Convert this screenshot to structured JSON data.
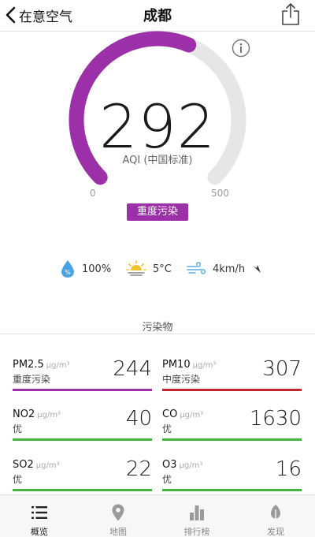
{
  "nav": {
    "back_label": "在意空气",
    "title": "成都"
  },
  "aqi": {
    "value": "292",
    "label": "AQI (中国标准)",
    "scale_min": "0",
    "scale_max": "500",
    "level": "重度污染",
    "fraction": 0.584,
    "color": "#9c30a9",
    "track_color": "#e6e6e6"
  },
  "weather": {
    "humidity": "100%",
    "temperature": "5°C",
    "wind": "4km/h"
  },
  "section_title": "污染物",
  "pollutants": [
    {
      "name": "PM2.5",
      "unit": "µg/m³",
      "level": "重度污染",
      "value": "244",
      "color": "#9c30a9"
    },
    {
      "name": "PM10",
      "unit": "µg/m³",
      "level": "中度污染",
      "value": "307",
      "color": "#c0272d"
    },
    {
      "name": "NO2",
      "unit": "µg/m³",
      "level": "优",
      "value": "40",
      "color": "#44b83a"
    },
    {
      "name": "CO",
      "unit": "µg/m³",
      "level": "优",
      "value": "1630",
      "color": "#44b83a"
    },
    {
      "name": "SO2",
      "unit": "µg/m³",
      "level": "优",
      "value": "22",
      "color": "#44b83a"
    },
    {
      "name": "O3",
      "unit": "µg/m³",
      "level": "优",
      "value": "16",
      "color": "#44b83a"
    }
  ],
  "tabs": [
    {
      "label": "概览",
      "icon": "list-icon",
      "active": true
    },
    {
      "label": "地图",
      "icon": "map-pin-icon",
      "active": false
    },
    {
      "label": "排行榜",
      "icon": "bar-chart-icon",
      "active": false
    },
    {
      "label": "发现",
      "icon": "leaf-icon",
      "active": false
    }
  ]
}
